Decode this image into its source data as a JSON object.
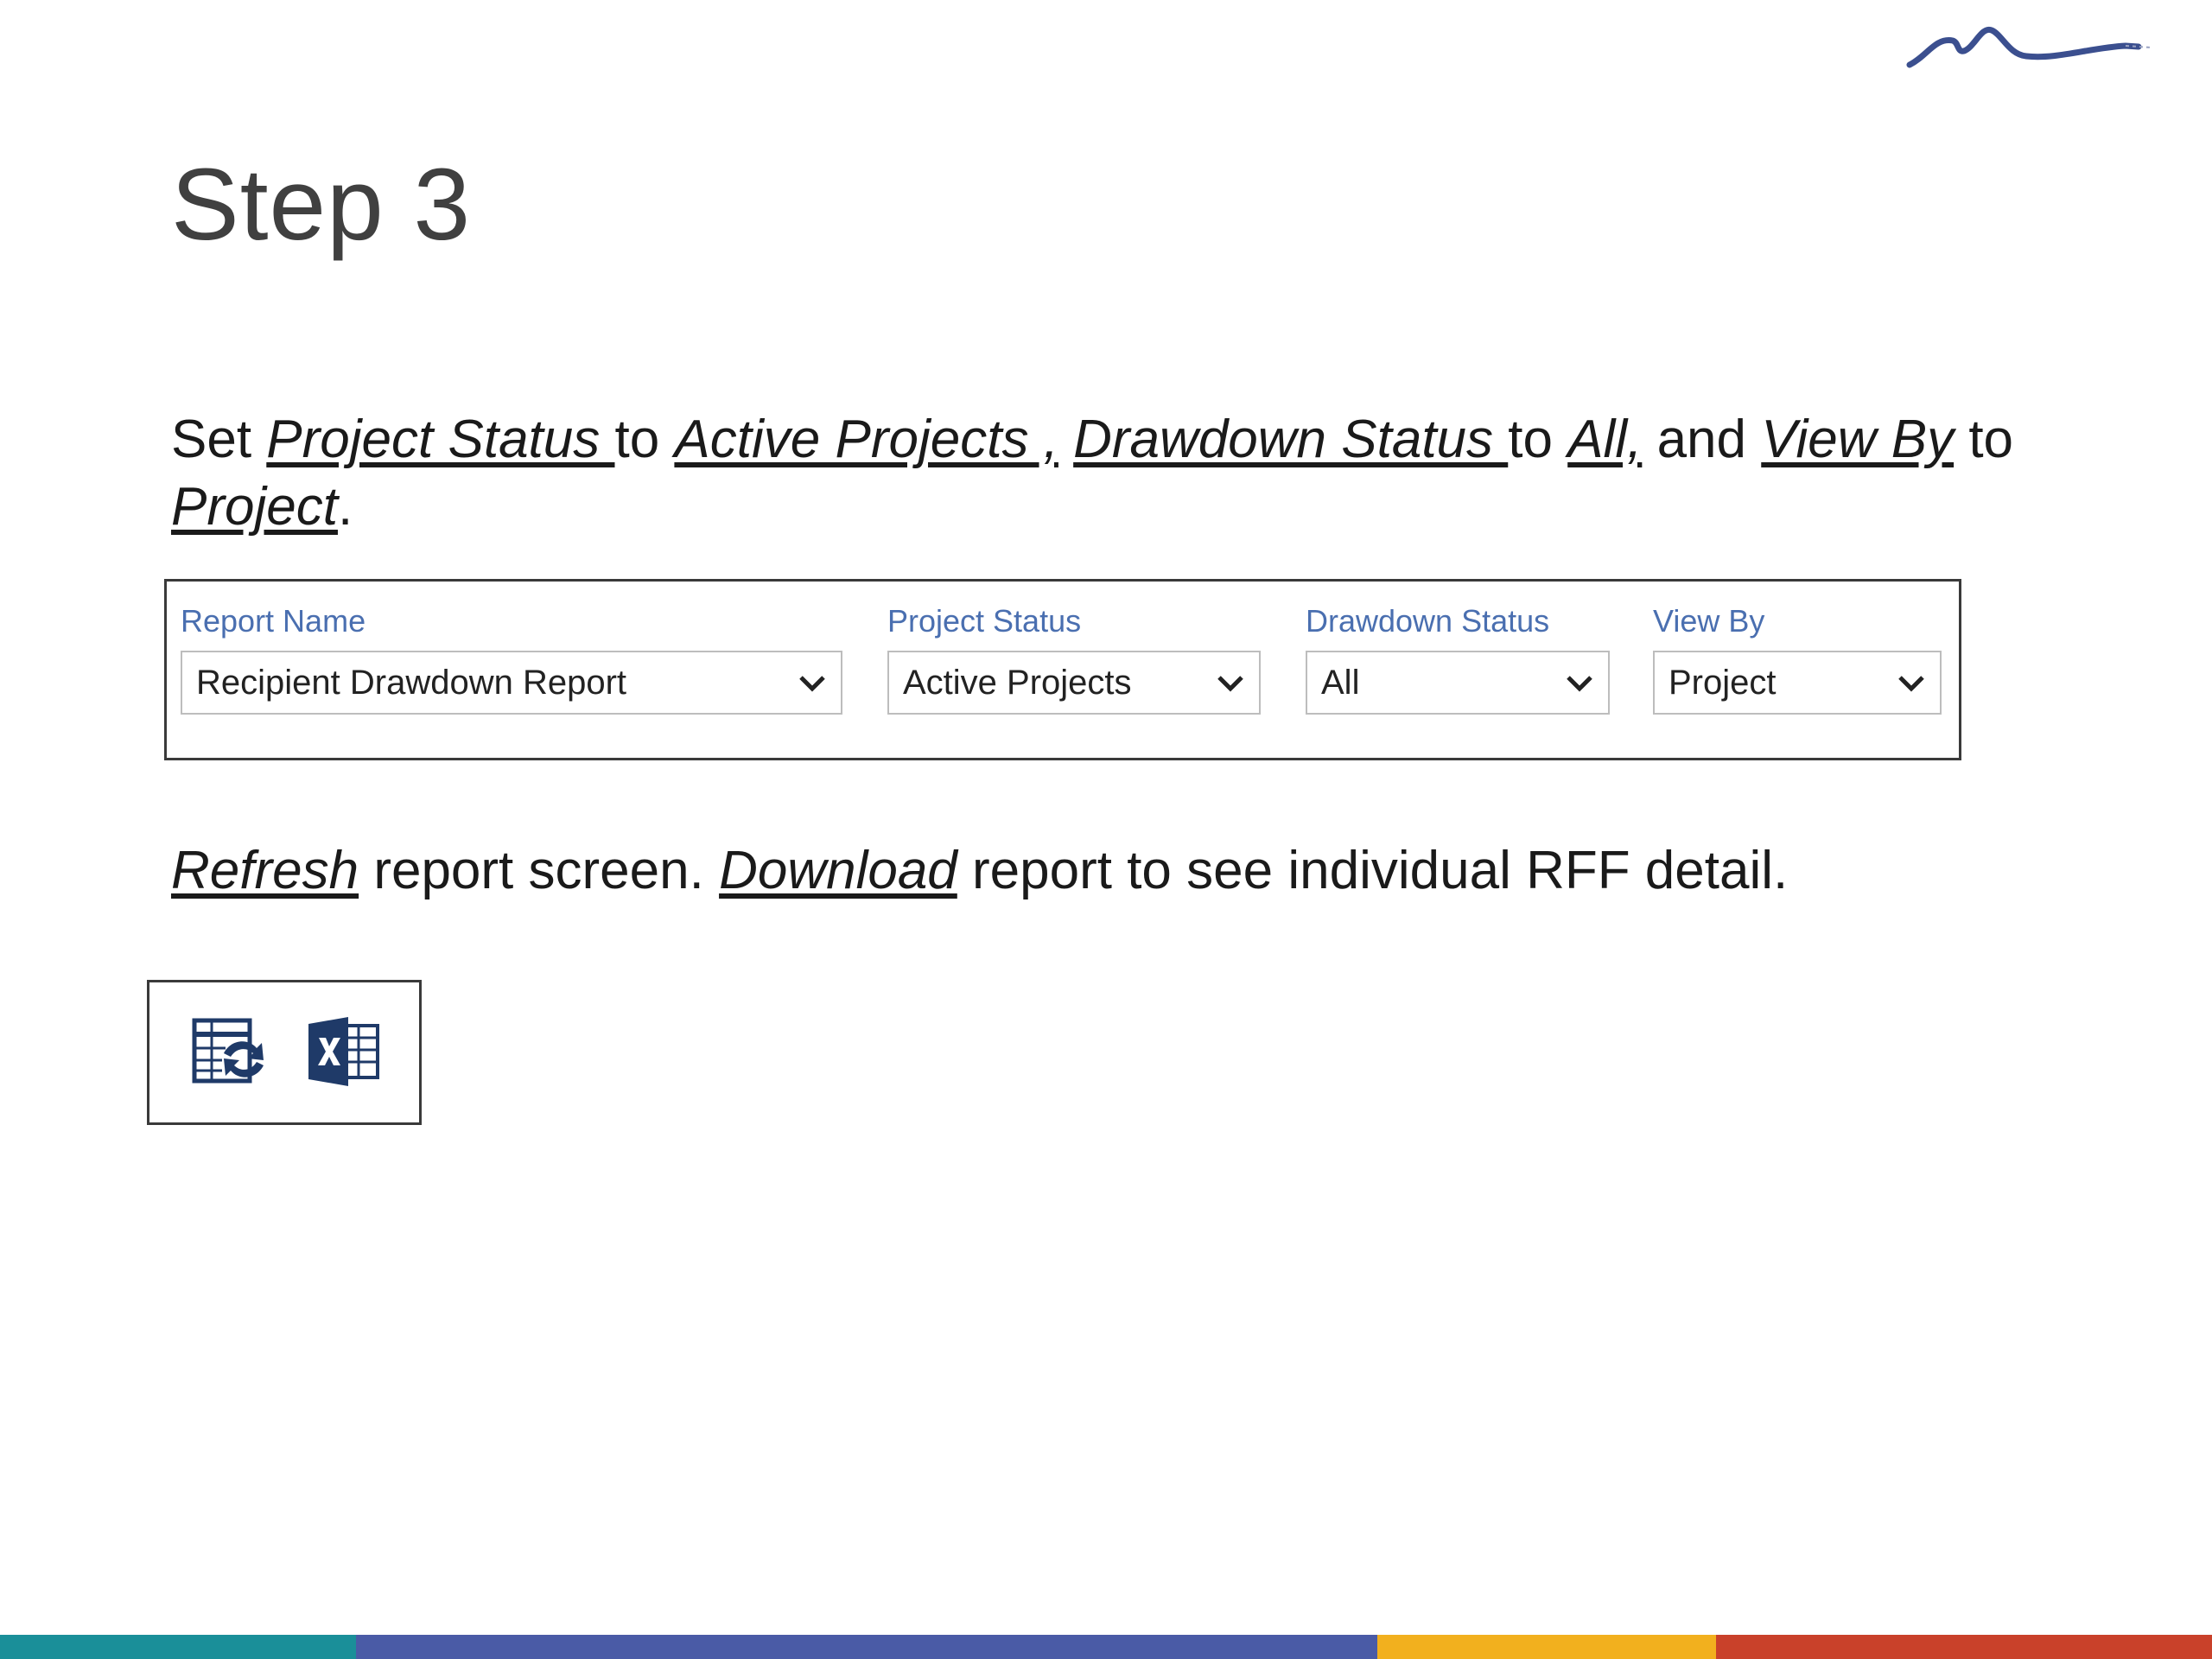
{
  "slide": {
    "title": "Step 3"
  },
  "instruction": {
    "p1": "Set ",
    "project_status": "Project Status ",
    "p2": "to ",
    "active_projects": "Active Projects ,",
    "p3": " ",
    "drawdown_status": "Drawdown Status ",
    "p4": "to ",
    "all": "All,",
    "p5": " and ",
    "view_by": "View By",
    "p6": " to ",
    "project": "Project",
    "p7": "."
  },
  "filters": {
    "report_name": {
      "label": "Report Name",
      "value": "Recipient Drawdown Report"
    },
    "project_status": {
      "label": "Project Status",
      "value": "Active Projects"
    },
    "drawdown_status": {
      "label": "Drawdown Status",
      "value": "All"
    },
    "view_by": {
      "label": "View By",
      "value": "Project"
    }
  },
  "instruction2": {
    "refresh": "Refresh",
    "p1": " report screen. ",
    "download": "Download",
    "p2": " report to see individual RFF detail."
  },
  "toolbar": {
    "refresh_icon": "table-refresh-icon",
    "excel_icon": "excel-icon"
  },
  "colors": {
    "label_blue": "#4a6fb0",
    "icon_navy": "#1f3a68",
    "logo_navy": "#3b4f8f",
    "footer": [
      "#1a8f99",
      "#4a5ba6",
      "#f2b01e",
      "#c9412a"
    ]
  }
}
